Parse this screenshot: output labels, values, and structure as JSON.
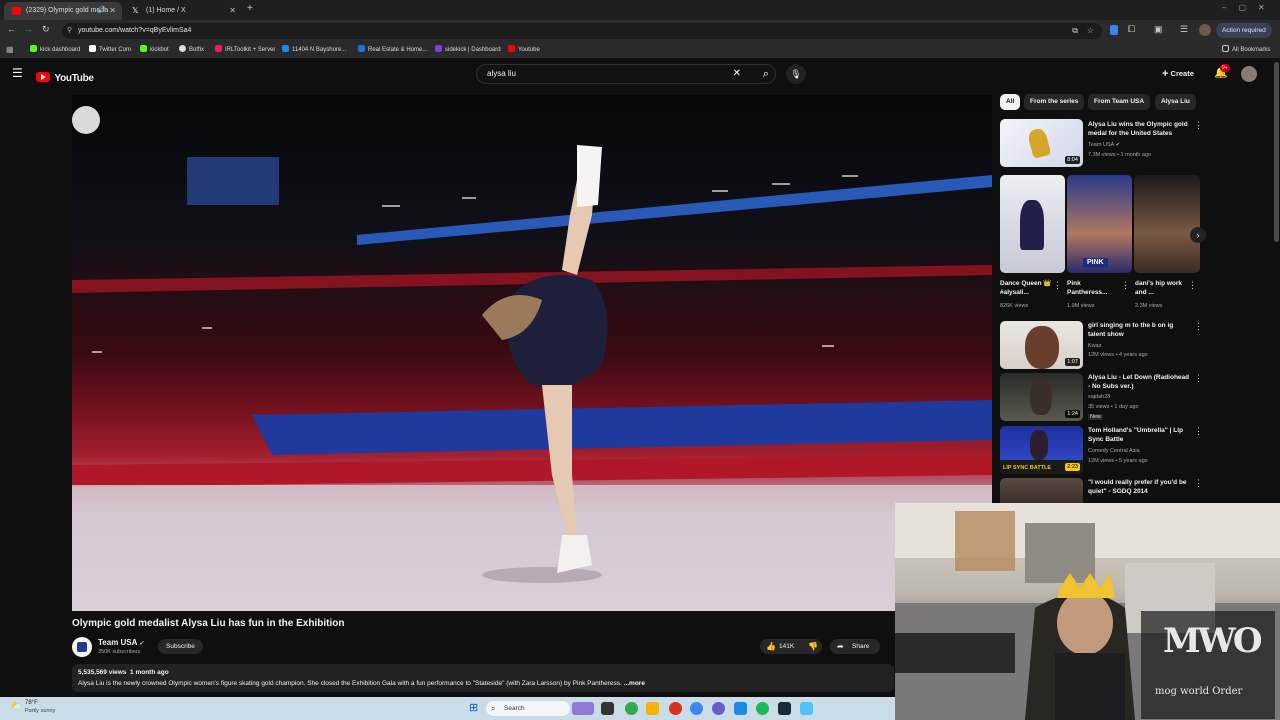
{
  "browser": {
    "tabs": [
      {
        "title": "(2329) Olympic gold meda",
        "active": true
      },
      {
        "title": "(1) Home / X",
        "active": false
      }
    ],
    "url": "youtube.com/watch?v=qByEvlimSa4",
    "action_required": "Action required",
    "bookmarks": [
      "kick dashboard",
      "Twitter Com",
      "kickbot",
      "Botfix",
      "IRLToolkit + Server",
      "11404 N Bayshore...",
      "Real Estate & Home...",
      "sidekick | Dashboard",
      "Youtube"
    ],
    "all_bookmarks": "All Bookmarks"
  },
  "youtube": {
    "logo": "YouTube",
    "search_query": "alysa liu",
    "create_label": "Create",
    "notif_count": "9+"
  },
  "video": {
    "title": "Olympic gold medalist Alysa Liu has fun in the Exhibition",
    "channel": "Team USA",
    "subscribers": "350K subscribers",
    "subscribe_label": "Subscribe",
    "likes": "141K",
    "share_label": "Share",
    "views_date": "5,535,569 views  1 month ago",
    "description": "Alysa Liu is the newly crowned Olympic women's figure skating gold champion. She closed the Exhibition Gala with a fun performance to \"Stateside\" (with Zara Larsson) by Pink Pantheress.",
    "more": "...more"
  },
  "chips": [
    "All",
    "From the series",
    "From Team USA",
    "Alysa Liu"
  ],
  "recs_top": {
    "title": "Alysa Liu wins the Olympic gold medal for the United States",
    "channel": "Team USA",
    "meta": "7.3M views • 1 month ago",
    "duration": "8:04"
  },
  "shorts": [
    {
      "title": "Dance Queen 👑 #alysali...",
      "views": "826K views"
    },
    {
      "title": "Pink Pantheress...",
      "views": "1.9M views",
      "overlay": "PINK"
    },
    {
      "title": "dani's hip work and ...",
      "views": "2.3M views"
    }
  ],
  "recs": [
    {
      "title": "girl singing m to the b on ig talent show",
      "channel": "Kwaz",
      "meta": "12M views • 4 years ago",
      "duration": "1:07",
      "badge": ""
    },
    {
      "title": "Alysa Liu - Let Down (Radiohead - No Subs ver.)",
      "channel": "sajdah28",
      "meta": "35 views • 1 day ago",
      "duration": "1:24",
      "badge": "New"
    },
    {
      "title": "Tom Holland's \"Umbrella\" | Lip Sync Battle",
      "channel": "Comedy Central Asia",
      "meta": "12M views • 5 years ago",
      "duration": "2:23",
      "badge": "",
      "thumb_text": "LIP SYNC BATTLE"
    },
    {
      "title": "\"I would really prefer if you'd be quiet\" - SGDQ 2014",
      "channel": "",
      "meta": "",
      "duration": "",
      "badge": ""
    }
  ],
  "weather": {
    "temp": "78°F",
    "desc": "Partly sunny"
  },
  "taskbar_search": "Search",
  "webcam_logo": "mog world Order",
  "webcam_logo_big": "MWO"
}
